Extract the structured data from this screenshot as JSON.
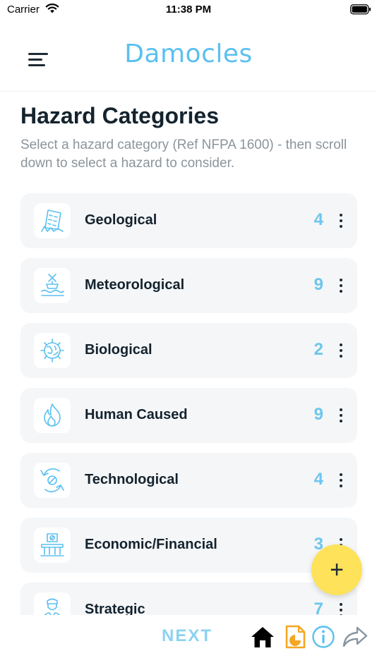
{
  "status_bar": {
    "carrier": "Carrier",
    "time": "11:38 PM"
  },
  "header": {
    "title": "Damocles"
  },
  "page": {
    "title": "Hazard Categories",
    "subtitle": "Select a hazard category (Ref NFPA 1600) - then scroll down to select a hazard to consider."
  },
  "categories": [
    {
      "label": "Geological",
      "count": "4",
      "icon": "collapsing-building-icon"
    },
    {
      "label": "Meteorological",
      "count": "9",
      "icon": "flood-icon"
    },
    {
      "label": "Biological",
      "count": "2",
      "icon": "virus-globe-icon"
    },
    {
      "label": "Human Caused",
      "count": "9",
      "icon": "fire-icon"
    },
    {
      "label": "Technological",
      "count": "4",
      "icon": "cycle-arrows-icon"
    },
    {
      "label": "Economic/Financial",
      "count": "3",
      "icon": "bank-icon"
    },
    {
      "label": "Strategic",
      "count": "7",
      "icon": "person-icon"
    }
  ],
  "actions": {
    "add_symbol": "+",
    "next_label": "NEXT"
  },
  "bottom_bar": {
    "icons": [
      "home-icon",
      "report-icon",
      "info-icon",
      "share-icon"
    ]
  },
  "colors": {
    "accent": "#5bc0f0",
    "count": "#6cc6ee",
    "fab": "#fde25a",
    "card": "#f4f6f8",
    "report": "#f5a623"
  }
}
